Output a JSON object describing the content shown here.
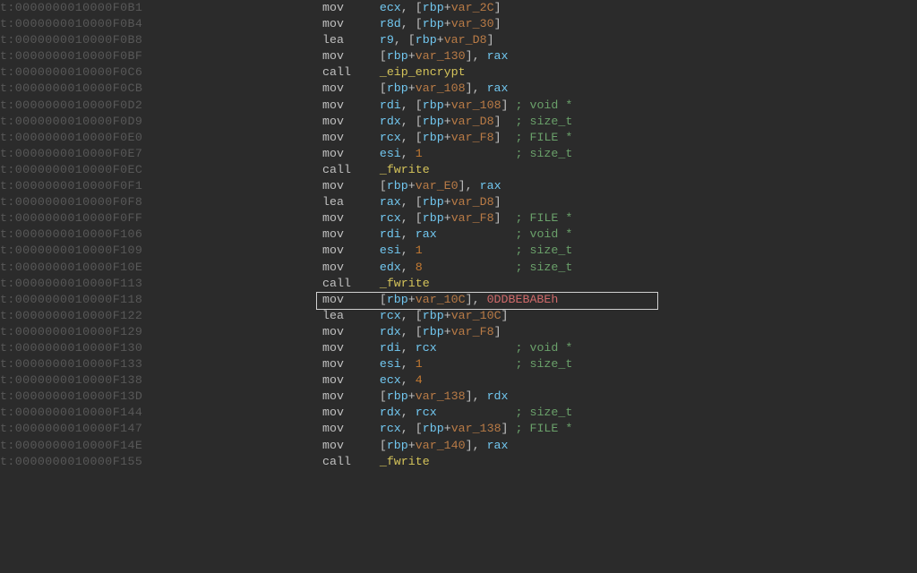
{
  "highlight_row": 17,
  "rows": [
    {
      "addr": "t:0000000010000F0B1",
      "tokens": [
        {
          "c": "mnem",
          "t": "mov     "
        },
        {
          "c": "reg",
          "t": "ecx"
        },
        {
          "c": "punct",
          "t": ", ["
        },
        {
          "c": "reg",
          "t": "rbp"
        },
        {
          "c": "punct",
          "t": "+"
        },
        {
          "c": "var",
          "t": "var_2C"
        },
        {
          "c": "punct",
          "t": "]"
        }
      ]
    },
    {
      "addr": "t:0000000010000F0B4",
      "tokens": [
        {
          "c": "mnem",
          "t": "mov     "
        },
        {
          "c": "reg",
          "t": "r8d"
        },
        {
          "c": "punct",
          "t": ", ["
        },
        {
          "c": "reg",
          "t": "rbp"
        },
        {
          "c": "punct",
          "t": "+"
        },
        {
          "c": "var",
          "t": "var_30"
        },
        {
          "c": "punct",
          "t": "]"
        }
      ]
    },
    {
      "addr": "t:0000000010000F0B8",
      "tokens": [
        {
          "c": "mnem",
          "t": "lea     "
        },
        {
          "c": "reg",
          "t": "r9"
        },
        {
          "c": "punct",
          "t": ", ["
        },
        {
          "c": "reg",
          "t": "rbp"
        },
        {
          "c": "punct",
          "t": "+"
        },
        {
          "c": "var",
          "t": "var_D8"
        },
        {
          "c": "punct",
          "t": "]"
        }
      ]
    },
    {
      "addr": "t:0000000010000F0BF",
      "tokens": [
        {
          "c": "mnem",
          "t": "mov     "
        },
        {
          "c": "punct",
          "t": "["
        },
        {
          "c": "reg",
          "t": "rbp"
        },
        {
          "c": "punct",
          "t": "+"
        },
        {
          "c": "var",
          "t": "var_130"
        },
        {
          "c": "punct",
          "t": "], "
        },
        {
          "c": "reg",
          "t": "rax"
        }
      ]
    },
    {
      "addr": "t:0000000010000F0C6",
      "tokens": [
        {
          "c": "mnem",
          "t": "call    "
        },
        {
          "c": "fn",
          "t": "_eip_encrypt"
        }
      ]
    },
    {
      "addr": "t:0000000010000F0CB",
      "tokens": [
        {
          "c": "mnem",
          "t": "mov     "
        },
        {
          "c": "punct",
          "t": "["
        },
        {
          "c": "reg",
          "t": "rbp"
        },
        {
          "c": "punct",
          "t": "+"
        },
        {
          "c": "var",
          "t": "var_108"
        },
        {
          "c": "punct",
          "t": "], "
        },
        {
          "c": "reg",
          "t": "rax"
        }
      ]
    },
    {
      "addr": "t:0000000010000F0D2",
      "tokens": [
        {
          "c": "mnem",
          "t": "mov     "
        },
        {
          "c": "reg",
          "t": "rdi"
        },
        {
          "c": "punct",
          "t": ", ["
        },
        {
          "c": "reg",
          "t": "rbp"
        },
        {
          "c": "punct",
          "t": "+"
        },
        {
          "c": "var",
          "t": "var_108"
        },
        {
          "c": "punct",
          "t": "] "
        },
        {
          "c": "cmt",
          "t": "; void *"
        }
      ]
    },
    {
      "addr": "t:0000000010000F0D9",
      "tokens": [
        {
          "c": "mnem",
          "t": "mov     "
        },
        {
          "c": "reg",
          "t": "rdx"
        },
        {
          "c": "punct",
          "t": ", ["
        },
        {
          "c": "reg",
          "t": "rbp"
        },
        {
          "c": "punct",
          "t": "+"
        },
        {
          "c": "var",
          "t": "var_D8"
        },
        {
          "c": "punct",
          "t": "]  "
        },
        {
          "c": "cmt",
          "t": "; size_t"
        }
      ]
    },
    {
      "addr": "t:0000000010000F0E0",
      "tokens": [
        {
          "c": "mnem",
          "t": "mov     "
        },
        {
          "c": "reg",
          "t": "rcx"
        },
        {
          "c": "punct",
          "t": ", ["
        },
        {
          "c": "reg",
          "t": "rbp"
        },
        {
          "c": "punct",
          "t": "+"
        },
        {
          "c": "var",
          "t": "var_F8"
        },
        {
          "c": "punct",
          "t": "]  "
        },
        {
          "c": "cmt",
          "t": "; FILE *"
        }
      ]
    },
    {
      "addr": "t:0000000010000F0E7",
      "tokens": [
        {
          "c": "mnem",
          "t": "mov     "
        },
        {
          "c": "reg",
          "t": "esi"
        },
        {
          "c": "punct",
          "t": ", "
        },
        {
          "c": "num",
          "t": "1"
        },
        {
          "c": "punct",
          "t": "             "
        },
        {
          "c": "cmt",
          "t": "; size_t"
        }
      ]
    },
    {
      "addr": "t:0000000010000F0EC",
      "tokens": [
        {
          "c": "mnem",
          "t": "call    "
        },
        {
          "c": "fn",
          "t": "_fwrite"
        }
      ]
    },
    {
      "addr": "t:0000000010000F0F1",
      "tokens": [
        {
          "c": "mnem",
          "t": "mov     "
        },
        {
          "c": "punct",
          "t": "["
        },
        {
          "c": "reg",
          "t": "rbp"
        },
        {
          "c": "punct",
          "t": "+"
        },
        {
          "c": "var",
          "t": "var_E0"
        },
        {
          "c": "punct",
          "t": "], "
        },
        {
          "c": "reg",
          "t": "rax"
        }
      ]
    },
    {
      "addr": "t:0000000010000F0F8",
      "tokens": [
        {
          "c": "mnem",
          "t": "lea     "
        },
        {
          "c": "reg",
          "t": "rax"
        },
        {
          "c": "punct",
          "t": ", ["
        },
        {
          "c": "reg",
          "t": "rbp"
        },
        {
          "c": "punct",
          "t": "+"
        },
        {
          "c": "var",
          "t": "var_D8"
        },
        {
          "c": "punct",
          "t": "]"
        }
      ]
    },
    {
      "addr": "t:0000000010000F0FF",
      "tokens": [
        {
          "c": "mnem",
          "t": "mov     "
        },
        {
          "c": "reg",
          "t": "rcx"
        },
        {
          "c": "punct",
          "t": ", ["
        },
        {
          "c": "reg",
          "t": "rbp"
        },
        {
          "c": "punct",
          "t": "+"
        },
        {
          "c": "var",
          "t": "var_F8"
        },
        {
          "c": "punct",
          "t": "]  "
        },
        {
          "c": "cmt",
          "t": "; FILE *"
        }
      ]
    },
    {
      "addr": "t:0000000010000F106",
      "tokens": [
        {
          "c": "mnem",
          "t": "mov     "
        },
        {
          "c": "reg",
          "t": "rdi"
        },
        {
          "c": "punct",
          "t": ", "
        },
        {
          "c": "reg",
          "t": "rax"
        },
        {
          "c": "punct",
          "t": "           "
        },
        {
          "c": "cmt",
          "t": "; void *"
        }
      ]
    },
    {
      "addr": "t:0000000010000F109",
      "tokens": [
        {
          "c": "mnem",
          "t": "mov     "
        },
        {
          "c": "reg",
          "t": "esi"
        },
        {
          "c": "punct",
          "t": ", "
        },
        {
          "c": "num",
          "t": "1"
        },
        {
          "c": "punct",
          "t": "             "
        },
        {
          "c": "cmt",
          "t": "; size_t"
        }
      ]
    },
    {
      "addr": "t:0000000010000F10E",
      "tokens": [
        {
          "c": "mnem",
          "t": "mov     "
        },
        {
          "c": "reg",
          "t": "edx"
        },
        {
          "c": "punct",
          "t": ", "
        },
        {
          "c": "num",
          "t": "8"
        },
        {
          "c": "punct",
          "t": "             "
        },
        {
          "c": "cmt",
          "t": "; size_t"
        }
      ]
    },
    {
      "addr": "t:0000000010000F113",
      "tokens": [
        {
          "c": "mnem",
          "t": "call    "
        },
        {
          "c": "fn",
          "t": "_fwrite"
        }
      ]
    },
    {
      "addr": "t:0000000010000F118",
      "tokens": [
        {
          "c": "mnem",
          "t": "mov     "
        },
        {
          "c": "punct",
          "t": "["
        },
        {
          "c": "reg",
          "t": "rbp"
        },
        {
          "c": "punct",
          "t": "+"
        },
        {
          "c": "var",
          "t": "var_10C"
        },
        {
          "c": "punct",
          "t": "], "
        },
        {
          "c": "lit",
          "t": "0DDBEBABEh"
        }
      ]
    },
    {
      "addr": "t:0000000010000F122",
      "tokens": [
        {
          "c": "mnem",
          "t": "lea     "
        },
        {
          "c": "reg",
          "t": "rcx"
        },
        {
          "c": "punct",
          "t": ", ["
        },
        {
          "c": "reg",
          "t": "rbp"
        },
        {
          "c": "punct",
          "t": "+"
        },
        {
          "c": "var",
          "t": "var_10C"
        },
        {
          "c": "punct",
          "t": "]"
        }
      ]
    },
    {
      "addr": "t:0000000010000F129",
      "tokens": [
        {
          "c": "mnem",
          "t": "mov     "
        },
        {
          "c": "reg",
          "t": "rdx"
        },
        {
          "c": "punct",
          "t": ", ["
        },
        {
          "c": "reg",
          "t": "rbp"
        },
        {
          "c": "punct",
          "t": "+"
        },
        {
          "c": "var",
          "t": "var_F8"
        },
        {
          "c": "punct",
          "t": "]"
        }
      ]
    },
    {
      "addr": "t:0000000010000F130",
      "tokens": [
        {
          "c": "mnem",
          "t": "mov     "
        },
        {
          "c": "reg",
          "t": "rdi"
        },
        {
          "c": "punct",
          "t": ", "
        },
        {
          "c": "reg",
          "t": "rcx"
        },
        {
          "c": "punct",
          "t": "           "
        },
        {
          "c": "cmt",
          "t": "; void *"
        }
      ]
    },
    {
      "addr": "t:0000000010000F133",
      "tokens": [
        {
          "c": "mnem",
          "t": "mov     "
        },
        {
          "c": "reg",
          "t": "esi"
        },
        {
          "c": "punct",
          "t": ", "
        },
        {
          "c": "num",
          "t": "1"
        },
        {
          "c": "punct",
          "t": "             "
        },
        {
          "c": "cmt",
          "t": "; size_t"
        }
      ]
    },
    {
      "addr": "t:0000000010000F138",
      "tokens": [
        {
          "c": "mnem",
          "t": "mov     "
        },
        {
          "c": "reg",
          "t": "ecx"
        },
        {
          "c": "punct",
          "t": ", "
        },
        {
          "c": "num",
          "t": "4"
        }
      ]
    },
    {
      "addr": "t:0000000010000F13D",
      "tokens": [
        {
          "c": "mnem",
          "t": "mov     "
        },
        {
          "c": "punct",
          "t": "["
        },
        {
          "c": "reg",
          "t": "rbp"
        },
        {
          "c": "punct",
          "t": "+"
        },
        {
          "c": "var",
          "t": "var_138"
        },
        {
          "c": "punct",
          "t": "], "
        },
        {
          "c": "reg",
          "t": "rdx"
        }
      ]
    },
    {
      "addr": "t:0000000010000F144",
      "tokens": [
        {
          "c": "mnem",
          "t": "mov     "
        },
        {
          "c": "reg",
          "t": "rdx"
        },
        {
          "c": "punct",
          "t": ", "
        },
        {
          "c": "reg",
          "t": "rcx"
        },
        {
          "c": "punct",
          "t": "           "
        },
        {
          "c": "cmt",
          "t": "; size_t"
        }
      ]
    },
    {
      "addr": "t:0000000010000F147",
      "tokens": [
        {
          "c": "mnem",
          "t": "mov     "
        },
        {
          "c": "reg",
          "t": "rcx"
        },
        {
          "c": "punct",
          "t": ", ["
        },
        {
          "c": "reg",
          "t": "rbp"
        },
        {
          "c": "punct",
          "t": "+"
        },
        {
          "c": "var",
          "t": "var_138"
        },
        {
          "c": "punct",
          "t": "] "
        },
        {
          "c": "cmt",
          "t": "; FILE *"
        }
      ]
    },
    {
      "addr": "t:0000000010000F14E",
      "tokens": [
        {
          "c": "mnem",
          "t": "mov     "
        },
        {
          "c": "punct",
          "t": "["
        },
        {
          "c": "reg",
          "t": "rbp"
        },
        {
          "c": "punct",
          "t": "+"
        },
        {
          "c": "var",
          "t": "var_140"
        },
        {
          "c": "punct",
          "t": "], "
        },
        {
          "c": "reg",
          "t": "rax"
        }
      ]
    },
    {
      "addr": "t:0000000010000F155",
      "tokens": [
        {
          "c": "mnem",
          "t": "call    "
        },
        {
          "c": "fn",
          "t": "_fwrite"
        }
      ]
    }
  ]
}
